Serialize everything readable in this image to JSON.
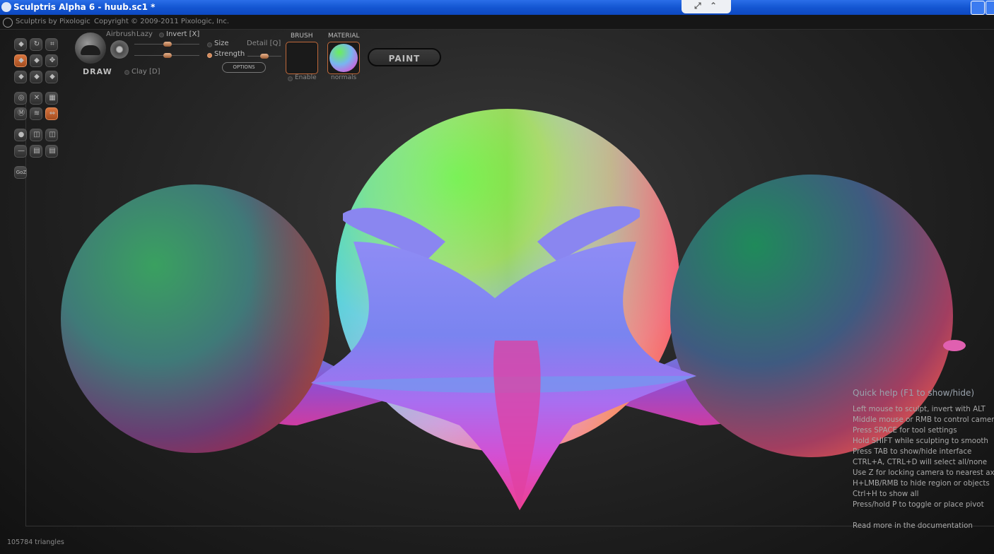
{
  "window": {
    "title": "Sculptris Alpha 6 - huub.sc1 *"
  },
  "app": {
    "by": "Sculptris by Pixologic",
    "copyright": "Copyright © 2009-2011 Pixologic, Inc."
  },
  "brush_panel": {
    "tool_name": "DRAW",
    "airbrush": "Airbrush",
    "lazy": "Lazy",
    "invert": "Invert [X]",
    "size": "Size",
    "strength": "Strength",
    "detail": "Detail [Q]",
    "clay": "Clay [D]",
    "options": "OPTIONS",
    "size_level": 0.5,
    "strength_level": 0.5,
    "detail_level": 0.5
  },
  "brush_section": {
    "label": "BRUSH",
    "enable": "Enable"
  },
  "material_section": {
    "label": "MATERIAL",
    "name": "normals"
  },
  "paint_button": "PAINT",
  "toolbar_icons": [
    "draw-icon",
    "rotate-icon",
    "crop-icon",
    "flatten-icon",
    "inflate-icon",
    "move-icon",
    "pinch-icon",
    "crease-icon",
    "smooth-icon",
    "symmetry-icon",
    "scale-icon",
    "grid-icon",
    "mask-icon",
    "wave-icon",
    "mirror-icon",
    "sphere-icon",
    "obj-import-icon",
    "obj-export-icon",
    "minus-icon",
    "save-icon",
    "save-as-icon",
    "goz-icon"
  ],
  "goz_label": "GoZ",
  "quick_help": {
    "title": "Quick help (F1 to show/hide)",
    "lines": [
      "Left mouse to sculpt, invert with ALT",
      "Middle mouse or RMB to control camera",
      "Press SPACE for tool settings",
      "Hold SHIFT while sculpting to smooth",
      "Press TAB to show/hide interface",
      "CTRL+A, CTRL+D will select all/none",
      "Use Z for locking camera to nearest axis",
      "H+LMB/RMB to hide region or objects",
      "Ctrl+H to show all",
      "Press/hold P to toggle or place pivot"
    ],
    "more": "Read more in the documentation"
  },
  "status": {
    "triangles": "105784 triangles"
  },
  "colors": {
    "accent": "#d7743e",
    "title_bar": "#1456d2"
  }
}
